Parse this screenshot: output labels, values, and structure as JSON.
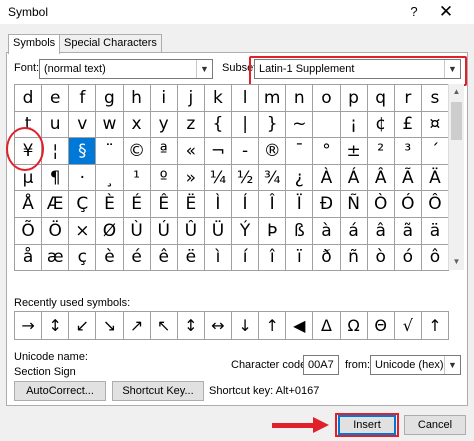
{
  "window": {
    "title": "Symbol",
    "help": "?",
    "close": "✕"
  },
  "tabs": [
    {
      "label": "Symbols",
      "active": true
    },
    {
      "label": "Special Characters",
      "active": false
    }
  ],
  "font": {
    "label": "Font:",
    "value": "(normal text)"
  },
  "subset": {
    "label": "Subset:",
    "value": "Latin-1 Supplement"
  },
  "symbols": [
    [
      "d",
      "e",
      "f",
      "g",
      "h",
      "i",
      "j",
      "k",
      "l",
      "m",
      "n",
      "o",
      "p",
      "q",
      "r",
      "s"
    ],
    [
      "t",
      "u",
      "v",
      "w",
      "x",
      "y",
      "z",
      "{",
      "|",
      "}",
      "~",
      "",
      "¡",
      "¢",
      "£",
      "¤"
    ],
    [
      "¥",
      "¦",
      "§",
      "¨",
      "©",
      "ª",
      "«",
      "¬",
      "-",
      "®",
      "¯",
      "°",
      "±",
      "²",
      "³",
      "´"
    ],
    [
      "µ",
      "¶",
      "·",
      "¸",
      "¹",
      "º",
      "»",
      "¼",
      "½",
      "¾",
      "¿",
      "À",
      "Á",
      "Â",
      "Ã",
      "Ä"
    ],
    [
      "Å",
      "Æ",
      "Ç",
      "È",
      "É",
      "Ê",
      "Ë",
      "Ì",
      "Í",
      "Î",
      "Ï",
      "Ð",
      "Ñ",
      "Ò",
      "Ó",
      "Ô"
    ],
    [
      "Õ",
      "Ö",
      "×",
      "Ø",
      "Ù",
      "Ú",
      "Û",
      "Ü",
      "Ý",
      "Þ",
      "ß",
      "à",
      "á",
      "â",
      "ã",
      "ä"
    ],
    [
      "å",
      "æ",
      "ç",
      "è",
      "é",
      "ê",
      "ë",
      "ì",
      "í",
      "î",
      "ï",
      "ð",
      "ñ",
      "ò",
      "ó",
      "ô"
    ]
  ],
  "selected_symbol": "§",
  "recent": {
    "label": "Recently used symbols:",
    "symbols": [
      "→",
      "↕",
      "↙",
      "↘",
      "↗",
      "↖",
      "↕",
      "↔",
      "↓",
      "↑",
      "◀",
      "Δ",
      "Ω",
      "Θ",
      "√",
      "↑",
      "€"
    ]
  },
  "unicode": {
    "label": "Unicode name:",
    "value": "Section Sign"
  },
  "char_code": {
    "label": "Character code:",
    "value": "00A7",
    "from_label": "from:",
    "from_value": "Unicode (hex)"
  },
  "buttons": {
    "autocorrect": "AutoCorrect...",
    "shortcut_key": "Shortcut Key...",
    "insert": "Insert",
    "cancel": "Cancel"
  },
  "shortcut": {
    "text": "Shortcut key: Alt+0167"
  },
  "scroll": {
    "up": "▲",
    "down": "▼"
  },
  "colors": {
    "selection": "#0078d7",
    "annotation": "#e0202b"
  }
}
